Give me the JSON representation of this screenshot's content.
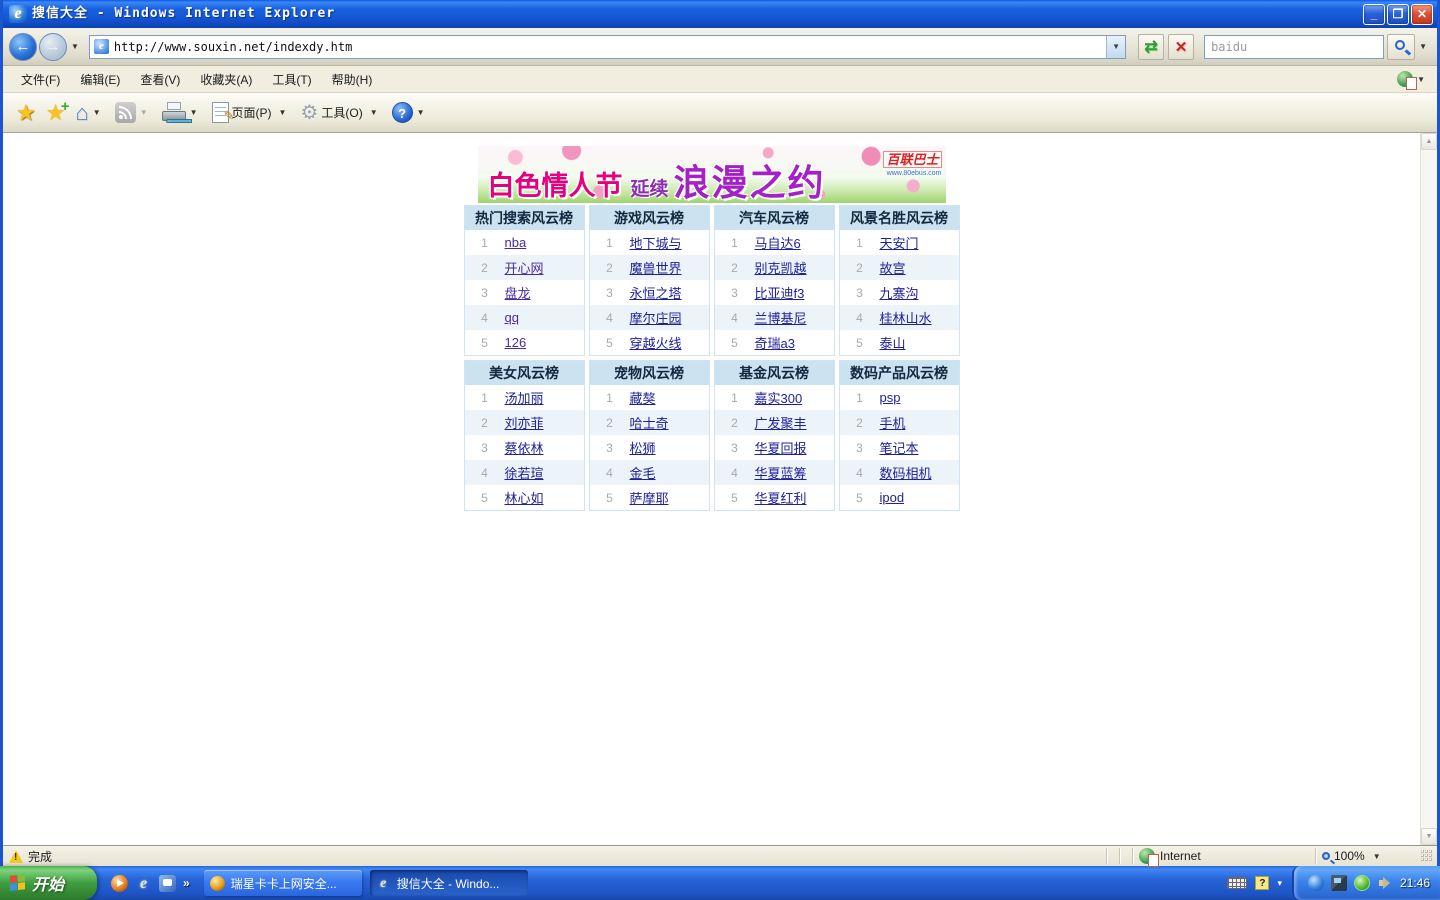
{
  "window": {
    "title": "搜信大全 - Windows Internet Explorer"
  },
  "nav": {
    "url": "http://www.souxin.net/indexdy.htm",
    "search_value": "baidu"
  },
  "menu": {
    "items": [
      "文件(F)",
      "编辑(E)",
      "查看(V)",
      "收藏夹(A)",
      "工具(T)",
      "帮助(H)"
    ]
  },
  "toolbar": {
    "page_label": "页面(P)",
    "tools_label": "工具(O)"
  },
  "banner": {
    "part1": "白色情人节",
    "part2": "延续",
    "part3": "浪漫之约",
    "logo": "百联巴士",
    "logo_sub": "www.80ebus.com"
  },
  "boards": [
    {
      "title": "热门搜索风云榜",
      "visited": true,
      "items": [
        "nba",
        "开心网",
        "盘龙",
        "qq",
        "126"
      ]
    },
    {
      "title": "游戏风云榜",
      "visited": false,
      "items": [
        "地下城与",
        "魔兽世界",
        "永恒之塔",
        "摩尔庄园",
        "穿越火线"
      ]
    },
    {
      "title": "汽车风云榜",
      "visited": false,
      "items": [
        "马自达6",
        "别克凯越",
        "比亚迪f3",
        "兰博基尼",
        "奇瑞a3"
      ]
    },
    {
      "title": "风景名胜风云榜",
      "visited": false,
      "items": [
        "天安门",
        "故宫",
        "九寨沟",
        "桂林山水",
        "泰山"
      ]
    },
    {
      "title": "美女风云榜",
      "visited": false,
      "items": [
        "汤加丽",
        "刘亦菲",
        "蔡依林",
        "徐若瑄",
        "林心如"
      ]
    },
    {
      "title": "宠物风云榜",
      "visited": false,
      "items": [
        "藏獒",
        "哈士奇",
        "松狮",
        "金毛",
        "萨摩耶"
      ]
    },
    {
      "title": "基金风云榜",
      "visited": false,
      "items": [
        "嘉实300",
        "广发聚丰",
        "华夏回报",
        "华夏蓝筹",
        "华夏红利"
      ]
    },
    {
      "title": "数码产品风云榜",
      "visited": false,
      "items": [
        "psp",
        "手机",
        "笔记本",
        "数码相机",
        "ipod"
      ]
    }
  ],
  "status": {
    "done": "完成",
    "zone": "Internet",
    "zoom": "100%"
  },
  "taskbar": {
    "start_label": "开始",
    "tasks": [
      {
        "label": "瑞星卡卡上网安全...",
        "active": false
      },
      {
        "label": "搜信大全 - Windo...",
        "active": true
      }
    ],
    "time": "21:46"
  },
  "colors": {
    "accent_blue": "#1c55d0",
    "header_bg": "#cbe2f1",
    "link": "#1f219b",
    "link_visited": "#4a2b9e",
    "banner_pink": "#e5007d"
  }
}
